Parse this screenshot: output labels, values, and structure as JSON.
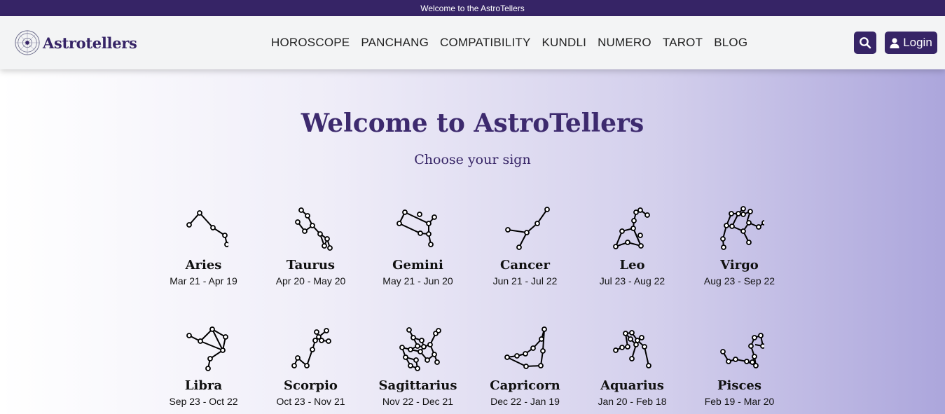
{
  "topbar": {
    "text": "Welcome to the AstroTellers"
  },
  "header": {
    "brand_name": "Astrotellers",
    "nav": [
      "HOROSCOPE",
      "PANCHANG",
      "COMPATIBILITY",
      "KUNDLI",
      "NUMERO",
      "TAROT",
      "BLOG"
    ],
    "login_label": "Login",
    "search_icon": "search-icon",
    "user_icon": "user-icon"
  },
  "hero": {
    "title": "Welcome to AstroTellers",
    "subtitle": "Choose your sign"
  },
  "signs": [
    {
      "name": "Aries",
      "dates": "Mar 21 - Apr 19"
    },
    {
      "name": "Taurus",
      "dates": "Apr 20 - May 20"
    },
    {
      "name": "Gemini",
      "dates": "May 21 - Jun 20"
    },
    {
      "name": "Cancer",
      "dates": "Jun 21 - Jul 22"
    },
    {
      "name": "Leo",
      "dates": "Jul 23 - Aug 22"
    },
    {
      "name": "Virgo",
      "dates": "Aug 23 - Sep 22"
    },
    {
      "name": "Libra",
      "dates": "Sep 23 - Oct 22"
    },
    {
      "name": "Scorpio",
      "dates": "Oct 23 - Nov 21"
    },
    {
      "name": "Sagittarius",
      "dates": "Nov 22 - Dec 21"
    },
    {
      "name": "Capricorn",
      "dates": "Dec 22 - Jan 19"
    },
    {
      "name": "Aquarius",
      "dates": "Jan 20 - Feb 18"
    },
    {
      "name": "Pisces",
      "dates": "Feb 19 - Mar 20"
    }
  ],
  "colors": {
    "primary": "#362466",
    "title": "#3d2a6e"
  }
}
